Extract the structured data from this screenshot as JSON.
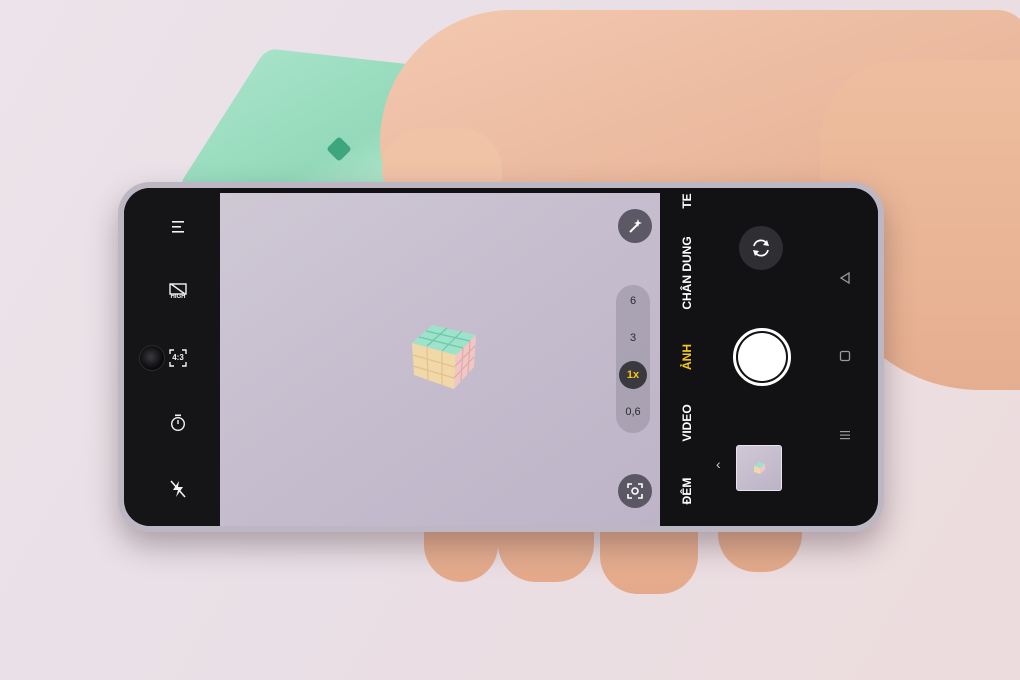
{
  "camera": {
    "top_bar": {
      "quality_label": "HIGH",
      "aspect_ratio": "4:3"
    },
    "zoom": {
      "levels": [
        "6",
        "3",
        "1x",
        "0,6"
      ],
      "selected": "1x"
    },
    "modes": {
      "partial_top": "TE",
      "portrait": "CHÂN DUNG",
      "photo": "ẢNH",
      "video": "VIDEO",
      "night": "ĐÊM",
      "active": "ẢNH"
    }
  },
  "icons": {
    "menu": "menu-icon",
    "hdr": "hdr-off-icon",
    "aspect": "aspect-ratio-icon",
    "timer": "timer-icon",
    "flash": "flash-off-icon",
    "magic": "magic-wand-icon",
    "focus": "focus-scan-icon",
    "flip": "camera-flip-icon",
    "back": "nav-back-icon",
    "home": "nav-home-icon",
    "recents": "nav-recents-icon"
  },
  "colors": {
    "accent_yellow": "#f5c518",
    "panel_black": "#121214",
    "viewfinder_lilac": "#c6bece",
    "cube_mint": "#a3e2c6",
    "cube_pink": "#f1c9c9",
    "cube_yellow": "#f2e3a8"
  }
}
